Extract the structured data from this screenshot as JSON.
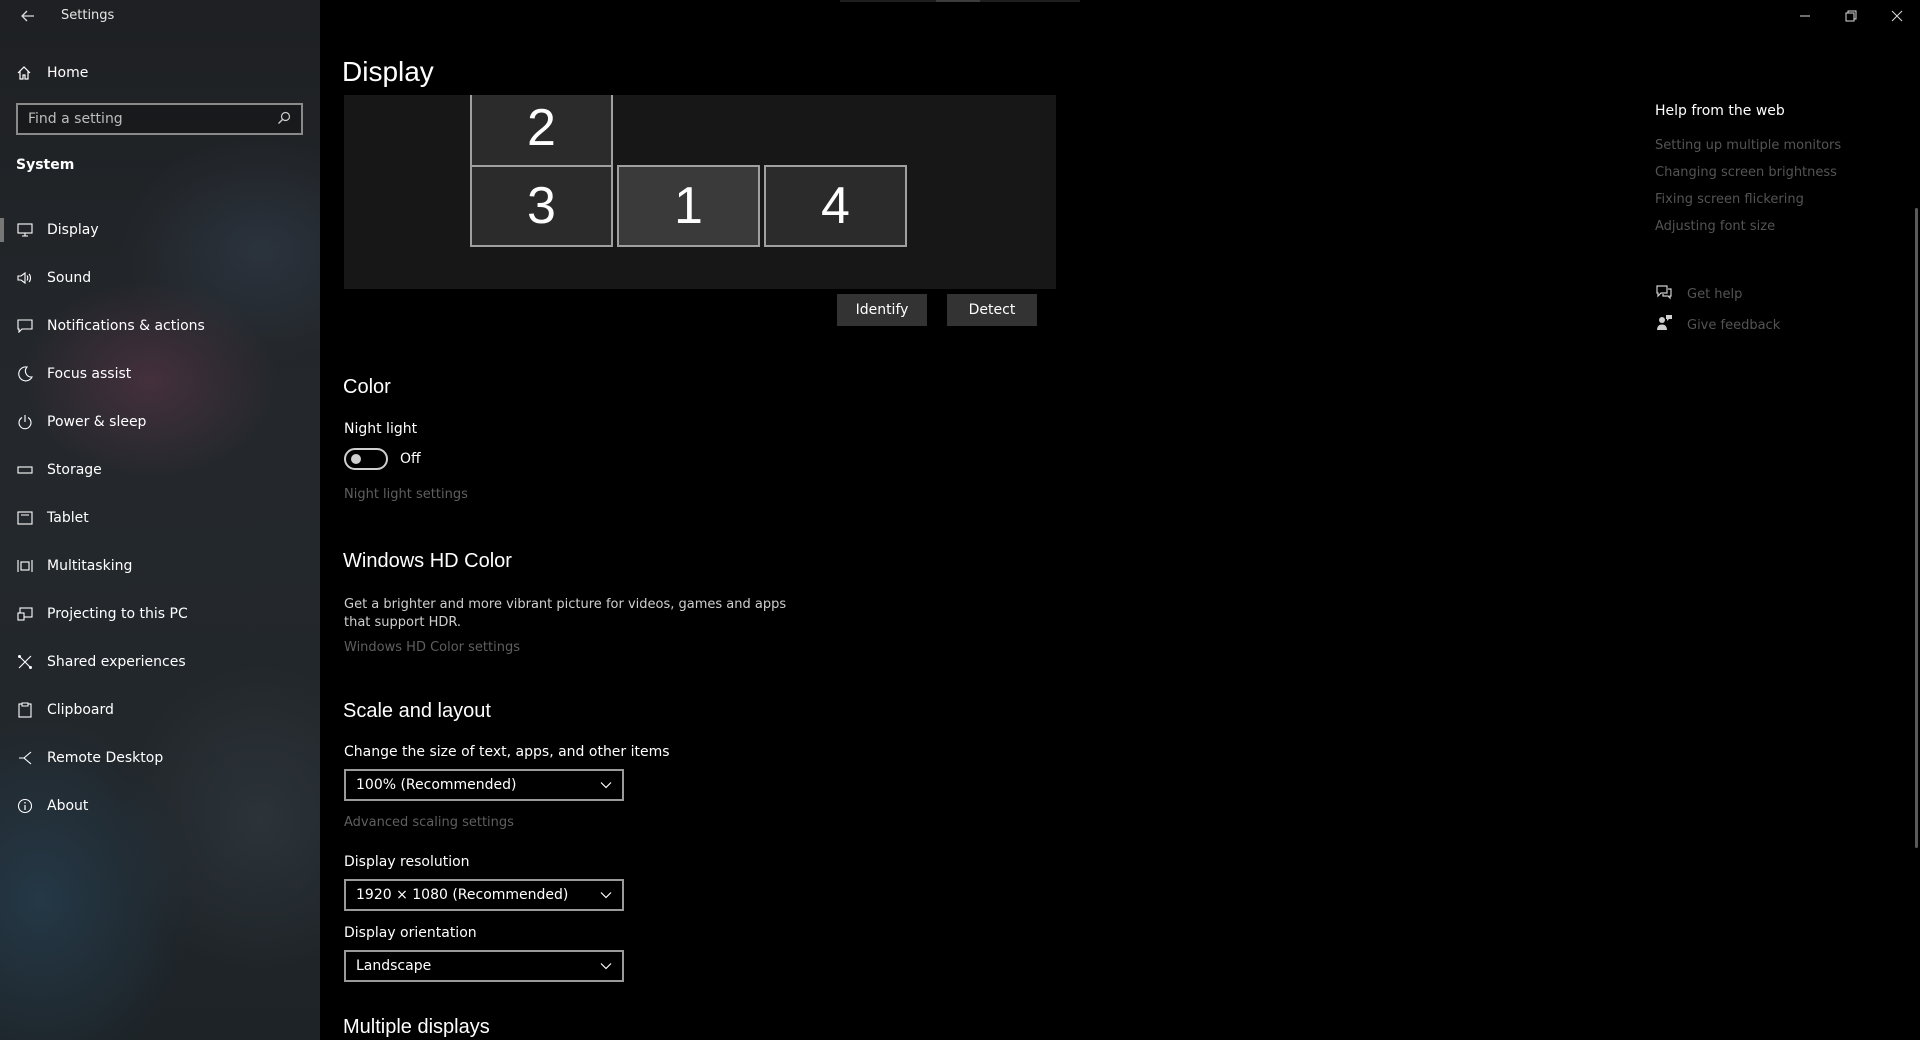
{
  "window": {
    "app_title": "Settings"
  },
  "sidebar": {
    "home_label": "Home",
    "search_placeholder": "Find a setting",
    "section_label": "System",
    "items": [
      {
        "label": "Display",
        "icon": "monitor-icon"
      },
      {
        "label": "Sound",
        "icon": "speaker-icon"
      },
      {
        "label": "Notifications & actions",
        "icon": "notification-icon"
      },
      {
        "label": "Focus assist",
        "icon": "moon-icon"
      },
      {
        "label": "Power & sleep",
        "icon": "power-icon"
      },
      {
        "label": "Storage",
        "icon": "storage-icon"
      },
      {
        "label": "Tablet",
        "icon": "tablet-icon"
      },
      {
        "label": "Multitasking",
        "icon": "multitasking-icon"
      },
      {
        "label": "Projecting to this PC",
        "icon": "projector-icon"
      },
      {
        "label": "Shared experiences",
        "icon": "shared-icon"
      },
      {
        "label": "Clipboard",
        "icon": "clipboard-icon"
      },
      {
        "label": "Remote Desktop",
        "icon": "remote-desktop-icon"
      },
      {
        "label": "About",
        "icon": "info-icon"
      }
    ]
  },
  "main": {
    "title": "Display",
    "monitors": [
      "2",
      "3",
      "1",
      "4"
    ],
    "identify_label": "Identify",
    "detect_label": "Detect",
    "color": {
      "heading": "Color",
      "night_light_label": "Night light",
      "night_light_state": "Off",
      "night_light_settings_link": "Night light settings"
    },
    "hdr": {
      "heading": "Windows HD Color",
      "description": "Get a brighter and more vibrant picture for videos, games and apps that support HDR.",
      "settings_link": "Windows HD Color settings"
    },
    "scale": {
      "heading": "Scale and layout",
      "size_label": "Change the size of text, apps, and other items",
      "size_value": "100% (Recommended)",
      "advanced_link": "Advanced scaling settings",
      "resolution_label": "Display resolution",
      "resolution_value": "1920 × 1080 (Recommended)",
      "orientation_label": "Display orientation",
      "orientation_value": "Landscape"
    },
    "multiple_heading": "Multiple displays"
  },
  "help": {
    "title": "Help from the web",
    "links": [
      "Setting up multiple monitors",
      "Changing screen brightness",
      "Fixing screen flickering",
      "Adjusting font size"
    ],
    "get_help": "Get help",
    "give_feedback": "Give feedback"
  },
  "colors": {
    "background": "#000000",
    "dim_text": "#5f5f5f",
    "button_bg": "#333333"
  }
}
